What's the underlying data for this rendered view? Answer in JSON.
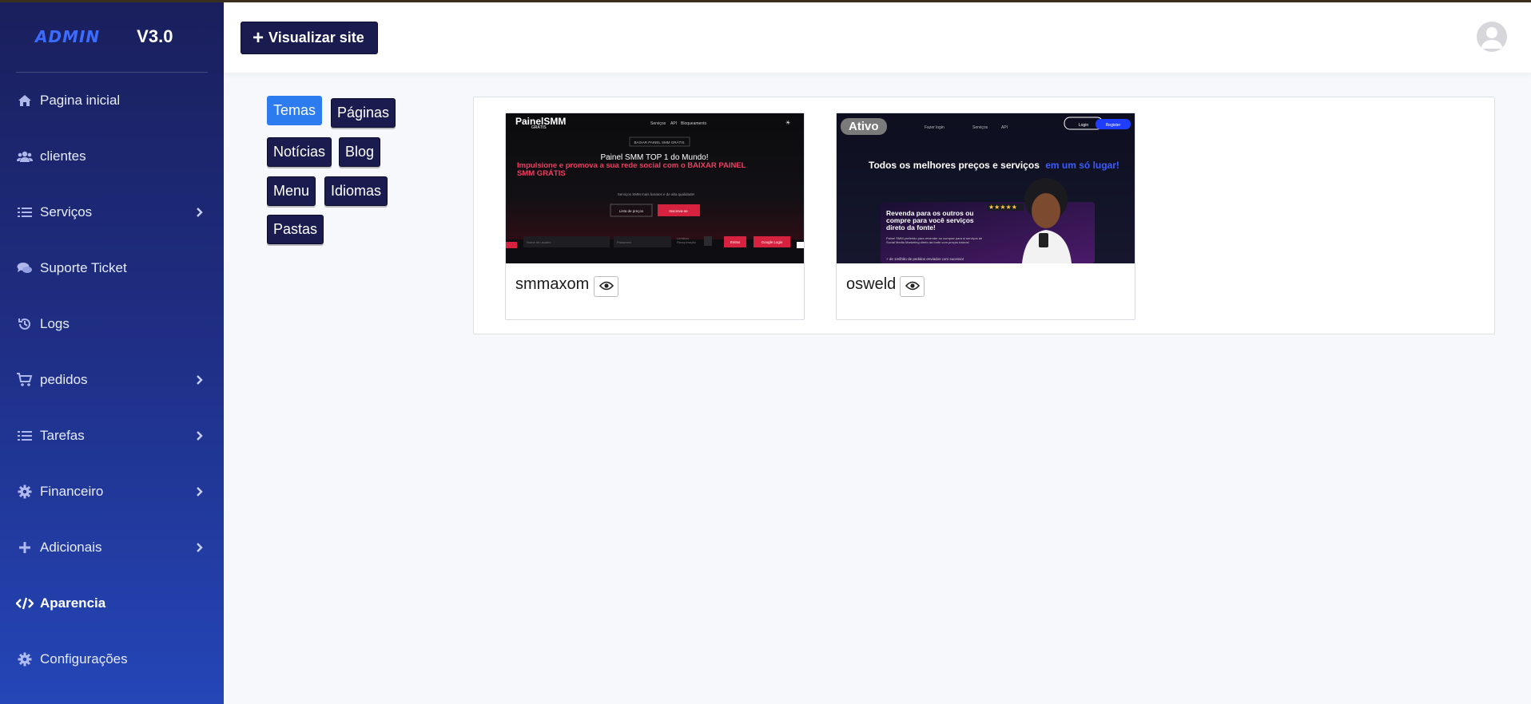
{
  "app": {
    "logo_text": "ADMIN",
    "version": "V3.0"
  },
  "sidebar": {
    "items": [
      {
        "label": "Pagina inicial",
        "icon": "home-icon",
        "has_submenu": false,
        "active": false
      },
      {
        "label": "clientes",
        "icon": "users-icon",
        "has_submenu": false,
        "active": false
      },
      {
        "label": "Serviços",
        "icon": "list-icon",
        "has_submenu": true,
        "active": false
      },
      {
        "label": "Suporte Ticket",
        "icon": "chat-icon",
        "has_submenu": false,
        "active": false
      },
      {
        "label": "Logs",
        "icon": "history-icon",
        "has_submenu": false,
        "active": false
      },
      {
        "label": "pedidos",
        "icon": "cart-icon",
        "has_submenu": true,
        "active": false
      },
      {
        "label": "Tarefas",
        "icon": "list-icon",
        "has_submenu": true,
        "active": false
      },
      {
        "label": "Financeiro",
        "icon": "gear-icon",
        "has_submenu": true,
        "active": false
      },
      {
        "label": "Adicionais",
        "icon": "plus-icon",
        "has_submenu": true,
        "active": false
      },
      {
        "label": "Aparencia",
        "icon": "code-icon",
        "has_submenu": false,
        "active": true
      },
      {
        "label": "Configurações",
        "icon": "gear-icon",
        "has_submenu": false,
        "active": false
      }
    ]
  },
  "header": {
    "view_site_label": "Visualizar site",
    "view_site_icon": "plus-icon",
    "avatar_icon": "user-avatar-icon"
  },
  "tabs": [
    {
      "label": "Temas",
      "active": true
    },
    {
      "label": "Páginas",
      "active": false
    },
    {
      "label": "Notícias",
      "active": false
    },
    {
      "label": "Blog",
      "active": false
    },
    {
      "label": "Menu",
      "active": false
    },
    {
      "label": "Idiomas",
      "active": false
    },
    {
      "label": "Pastas",
      "active": false
    }
  ],
  "themes": [
    {
      "name": "smmaxom",
      "active": false,
      "preview": {
        "logo": "PainelSMM",
        "logo_sub": "GRÁTIS",
        "nav": [
          "Serviços",
          "API",
          "Bloqueamento"
        ],
        "pill": "BAIXAR PAINEL SMM GRÁTIS",
        "headline": "Painel SMM TOP 1 do Mundo!",
        "subheadline": "Impulsione e promova a sua rede social com o BAIXAR PAINEL SMM GRÁTIS",
        "tagline": "Serviços SMM mais baratos e de alta qualidade!",
        "btn_secondary": "Lista de preços",
        "btn_primary": "Inscreva-se",
        "login_user": "Nome de usuário",
        "login_pass": "Password",
        "remember": "Lembrar Recuperação",
        "login_btn": "Entrar",
        "google_btn": "Google Login"
      }
    },
    {
      "name": "osweld",
      "active": true,
      "active_label": "Ativo",
      "preview": {
        "nav": [
          "Fazer login",
          "Serviços",
          "API"
        ],
        "btn_login": "Login",
        "btn_register": "Register",
        "headline_a": "Todos os melhores preços e serviços",
        "headline_b": "em um só lugar!",
        "card_title": "Revenda para os outros ou compre para você serviços direto da fonte!",
        "card_body": "Painel SMM preferido para revender ou comprar para si serviços de Social Media Marketing direto da fonte com preços baixos!",
        "stars": "★★★★★",
        "footer": "+ de 1milhão de pedidos enviados com sucesso!"
      }
    }
  ],
  "colors": {
    "sidebar_top": "#1a1f5c",
    "sidebar_bottom": "#2446b8",
    "dark_button": "#1a1c4f",
    "active_tab": "#2c7cf0",
    "logo_blue": "#3b6cff"
  }
}
